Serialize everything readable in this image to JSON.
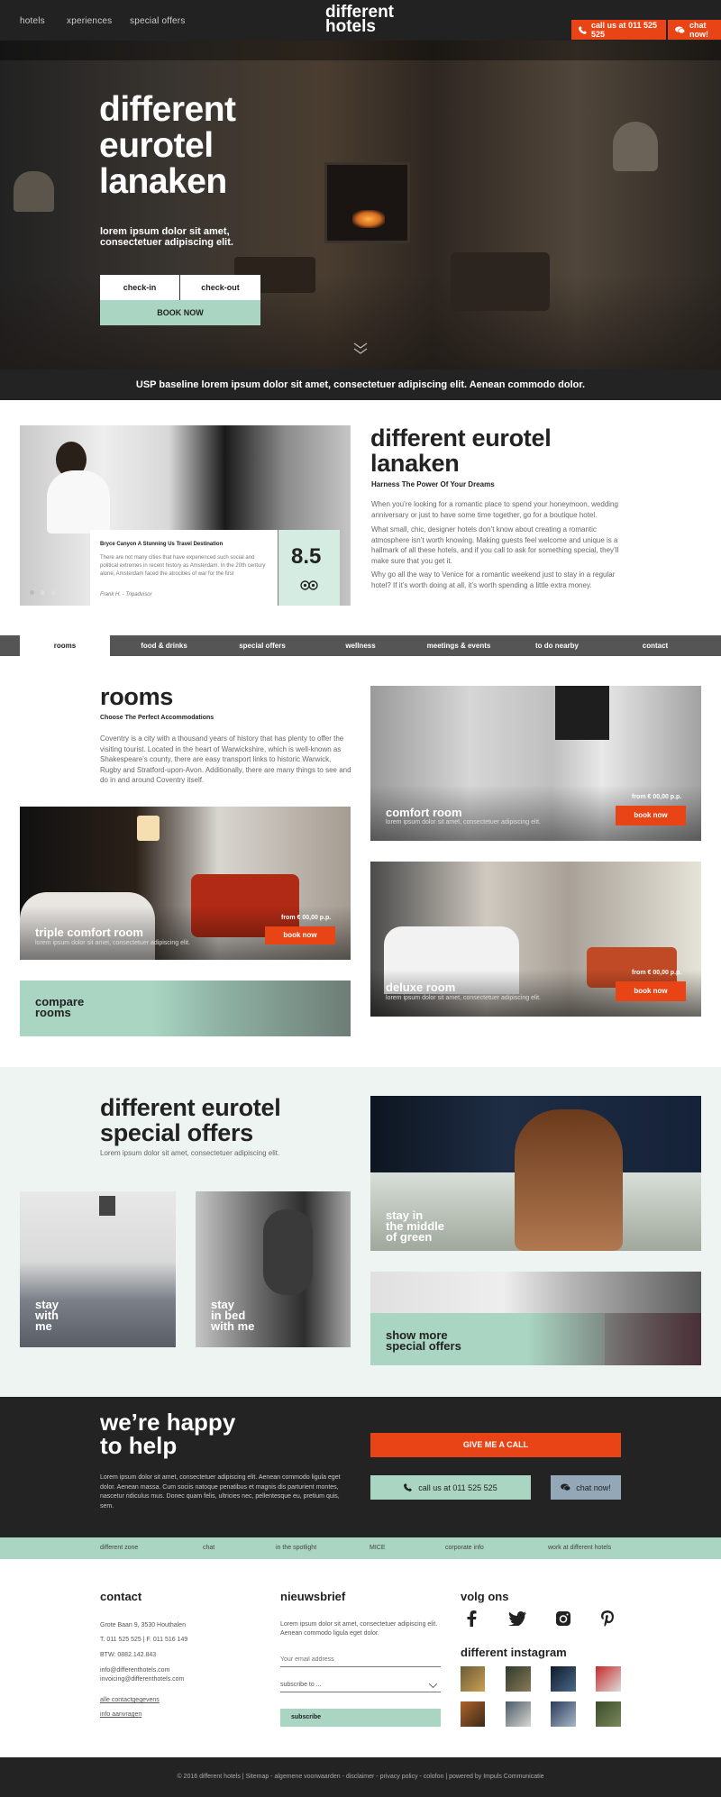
{
  "header": {
    "nav": [
      "hotels",
      "xperiences",
      "special offers"
    ],
    "logo_line1": "different",
    "logo_line2": "hotels",
    "call_label": "call us at 011 525 525",
    "chat_label": "chat now!"
  },
  "hero": {
    "title_line1": "different",
    "title_line2": "eurotel",
    "title_line3": "lanaken",
    "subtitle_line1": "lorem ipsum dolor sit amet,",
    "subtitle_line2": "consectetuer adipiscing elit.",
    "checkin": "check-in",
    "checkout": "check-out",
    "book": "BOOK NOW"
  },
  "usp": "USP baseline lorem ipsum dolor sit amet, consectetuer adipiscing elit. Aenean commodo dolor.",
  "review": {
    "title": "Bryce Canyon A Stunning Us Travel Destination",
    "text": "There are not many cities that have experienced such social and political extremes in recent history as Amsterdam. In the 20th century alone, Amsterdam faced the atrocities of war for the first",
    "author": "Frank H. - Tripadvisor",
    "score": "8.5"
  },
  "about": {
    "title_line1": "different eurotel",
    "title_line2": "lanaken",
    "subtitle": "Harness The Power Of Your Dreams",
    "p1": "When you’re looking for a romantic place to spend your honeymoon, wedding anniversary or just to have some time together, go for a boutique hotel.",
    "p2": "What small, chic, designer hotels don’t know about creating a romantic atmosphere isn’t worth knowing. Making guests feel welcome and unique is a hallmark of all these hotels, and if you call to ask for something special, they’ll make sure that you get it.",
    "p3": "Why go all the way to Venice for a romantic weekend just to stay in a regular hotel? If it’s worth doing at all, it’s worth spending a little extra money."
  },
  "tabs": [
    "rooms",
    "food & drinks",
    "special offers",
    "wellness",
    "meetings & events",
    "to do nearby",
    "contact"
  ],
  "rooms": {
    "title": "rooms",
    "subtitle": "Choose The Perfect Accommodations",
    "text": "Coventry is a city with a thousand years of history that has plenty to offer the visiting tourist. Located in the heart of Warwickshire, which is well-known as Shakespeare’s county, there are easy transport links to historic Warwick, Rugby and Stratford-upon-Avon. Additionally, there are many things to see and do in and around Coventry itself.",
    "items": [
      {
        "name": "comfort room",
        "desc": "lorem ipsum dolor sit amet, consectetuer adipiscing elit.",
        "price": "from € 00,00 p.p.",
        "btn": "book now"
      },
      {
        "name": "triple comfort room",
        "desc": "lorem ipsum dolor sit amet, consectetuer adipiscing elit.",
        "price": "from € 00,00 p.p.",
        "btn": "book now"
      },
      {
        "name": "deluxe room",
        "desc": "lorem ipsum dolor sit amet, consectetuer adipiscing elit.",
        "price": "from € 00,00 p.p.",
        "btn": "book now"
      }
    ],
    "compare_line1": "compare",
    "compare_line2": "rooms"
  },
  "offers": {
    "title_line1": "different eurotel",
    "title_line2": "special offers",
    "subtitle": "Lorem ipsum dolor sit amet, consectetuer adipiscing elit.",
    "green": [
      "stay in",
      "the middle",
      "of green"
    ],
    "stay": [
      "stay",
      "with",
      "me"
    ],
    "bed": [
      "stay",
      "in bed",
      "with me"
    ],
    "more_line1": "show more",
    "more_line2": "special offers"
  },
  "help": {
    "title_line1": "we’re happy",
    "title_line2": "to help",
    "text": "Lorem ipsum dolor sit amet, consectetuer adipiscing elit. Aenean commodo ligula eget dolor. Aenean massa. Cum sociis natoque penatibus et magnis dis parturient montes, nascetur ridiculus mus. Donec quam felis, ultricies nec, pellentesque eu, pretium quis, sem.",
    "callback": "GIVE ME A CALL",
    "call": "call us at 011 525 525",
    "chat": "chat now!"
  },
  "subnav": [
    "different zone",
    "chat",
    "in the spotlight",
    "MICE",
    "corporate info",
    "work at different hotels"
  ],
  "contact": {
    "title": "contact",
    "address": "Grote Baan 9, 3530 Houthalen",
    "phone": "T. 011 525 525 | F. 011 516 149",
    "vat": "BTW: 0882.142.843",
    "email1": "info@differenthotels.com",
    "email2": "invoicing@differenthotels.com",
    "link1": "alle contactgegevens",
    "link2": "info aanvragen"
  },
  "newsletter": {
    "title": "nieuwsbrief",
    "text": "Lorem ipsum dolor sit amet, consectetuer adipiscing elit. Aenean commodo ligula eget dolor.",
    "email_placeholder": "Your email address",
    "select": "subscribe to ...",
    "btn": "subscribe"
  },
  "social": {
    "title": "volg ons",
    "insta_title": "different instagram"
  },
  "footer": "© 2016 different hotels | Sitemap - algemene voorwaarden - disclaimer - privacy policy - colofon | powered by Impuls Communicatie"
}
